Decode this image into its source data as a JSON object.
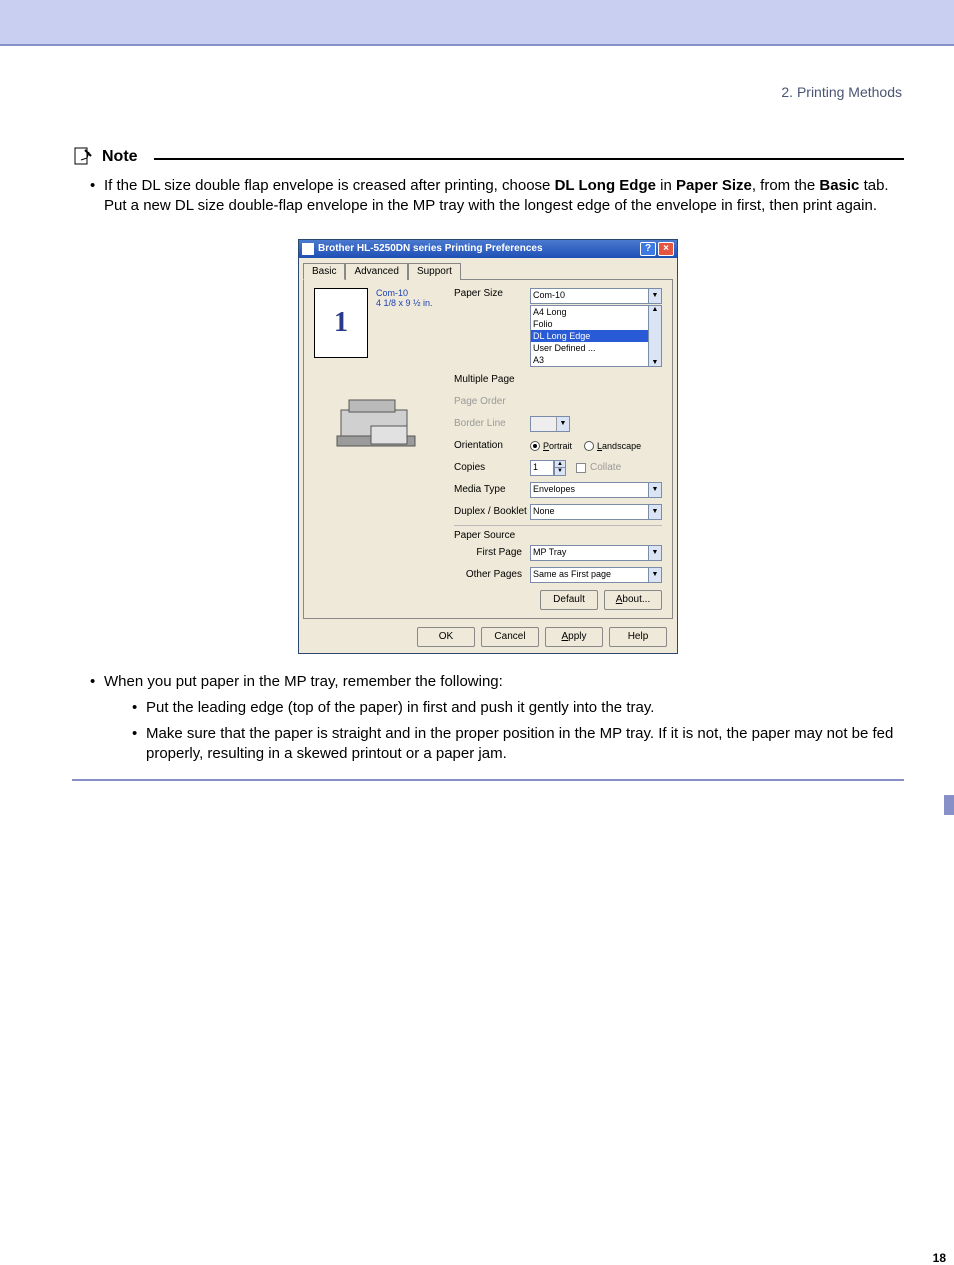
{
  "breadcrumb": "2. Printing Methods",
  "note": {
    "label": "Note",
    "bullet1_pre": "If the DL size double flap envelope is creased after printing, choose ",
    "bullet1_b1": "DL Long Edge",
    "bullet1_mid1": " in ",
    "bullet1_b2": "Paper Size",
    "bullet1_mid2": ", from the ",
    "bullet1_b3": "Basic",
    "bullet1_post": " tab. Put a new DL size double-flap envelope in the MP tray with the longest edge of the envelope in first, then print again."
  },
  "dialog": {
    "title": "Brother HL-5250DN series Printing Preferences",
    "tabs": {
      "t1": "Basic",
      "t2": "Advanced",
      "t3": "Support"
    },
    "preview": {
      "page_label": "Com-10",
      "size_label": "4 1/8 x 9 ½ in.",
      "big": "1"
    },
    "labels": {
      "paper_size": "Paper Size",
      "multiple_page": "Multiple Page",
      "page_order": "Page Order",
      "border_line": "Border Line",
      "orientation": "Orientation",
      "portrait": "Portrait",
      "landscape": "Landscape",
      "copies": "Copies",
      "collate": "Collate",
      "media_type": "Media Type",
      "duplex": "Duplex / Booklet",
      "paper_source": "Paper Source",
      "first_page": "First Page",
      "other_pages": "Other Pages"
    },
    "paper_size_value": "Com-10",
    "paper_size_list": [
      "A4 Long",
      "Folio",
      "DL Long Edge",
      "User Defined ...",
      "A3"
    ],
    "copies_value": "1",
    "media_type_value": "Envelopes",
    "duplex_value": "None",
    "first_page_value": "MP Tray",
    "other_pages_value": "Same as First page",
    "buttons": {
      "default": "Default",
      "about": "About...",
      "ok": "OK",
      "cancel": "Cancel",
      "apply": "Apply",
      "help": "Help"
    }
  },
  "after": {
    "b1": "When you put paper in the MP tray, remember the following:",
    "s1": "Put the leading edge (top of the paper) in first and push it gently into the tray.",
    "s2": "Make sure that the paper is straight and in the proper position in the MP tray. If it is not, the paper may not be fed properly, resulting in a skewed printout or a paper jam."
  },
  "page_number": "18"
}
